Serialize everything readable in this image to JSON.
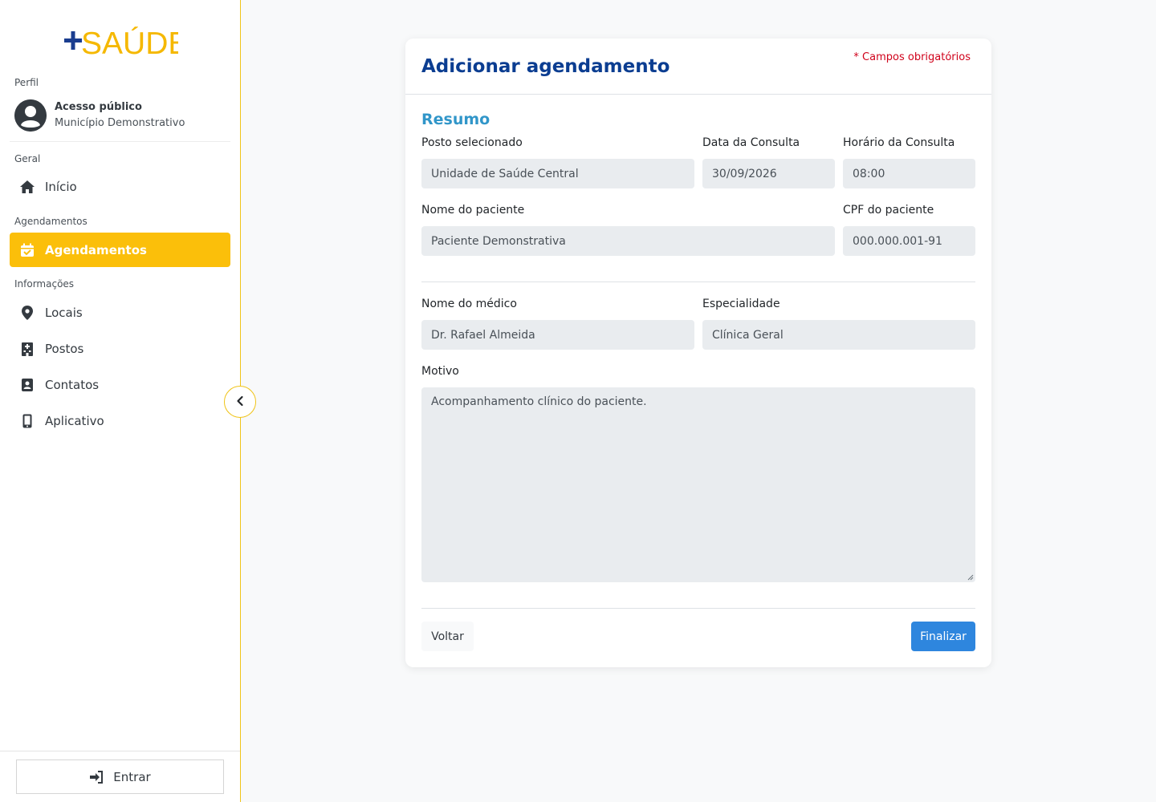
{
  "app": {
    "logo_text": "+SAÚDE",
    "logo_colors": {
      "plus": "#1a3d8f",
      "text": "#f5b800"
    }
  },
  "sidebar": {
    "profile_label": "Perfil",
    "profile": {
      "name": "Acesso público",
      "subtitle": "Município Demonstrativo",
      "icon": "user-circle-icon"
    },
    "groups": [
      {
        "label": "Geral"
      },
      {
        "label": "Agendamentos"
      },
      {
        "label": "Informações"
      }
    ],
    "items": [
      {
        "label": "Início",
        "icon": "home-icon"
      },
      {
        "label": "Agendamentos",
        "icon": "calendar-check-icon",
        "active": true
      },
      {
        "label": "Locais",
        "icon": "map-pin-icon"
      },
      {
        "label": "Postos",
        "icon": "building-icon"
      },
      {
        "label": "Contatos",
        "icon": "address-book-icon"
      },
      {
        "label": "Aplicativo",
        "icon": "mobile-icon"
      }
    ],
    "collapse_icon": "chevron-left-icon",
    "login_label": "Entrar",
    "login_icon": "sign-in-icon",
    "accent_color": "#fbbf0a"
  },
  "form": {
    "title": "Adicionar agendamento",
    "required_note": "* Campos obrigatórios",
    "section_title": "Resumo",
    "fields": {
      "posto": {
        "label": "Posto selecionado",
        "value": "Unidade de Saúde Central"
      },
      "data": {
        "label": "Data da Consulta",
        "value": "30/09/2026"
      },
      "horario": {
        "label": "Horário da Consulta",
        "value": "08:00"
      },
      "paciente": {
        "label": "Nome do paciente",
        "value": "Paciente Demonstrativa"
      },
      "cpf": {
        "label": "CPF do paciente",
        "value": "000.000.001-91"
      },
      "medico": {
        "label": "Nome do médico",
        "value": "Dr. Rafael Almeida"
      },
      "especialidade": {
        "label": "Especialidade",
        "value": "Clínica Geral"
      },
      "motivo": {
        "label": "Motivo",
        "value": "Acompanhamento clínico do paciente."
      }
    },
    "back_label": "Voltar",
    "finish_label": "Finalizar",
    "primary_color": "#2e86de"
  }
}
